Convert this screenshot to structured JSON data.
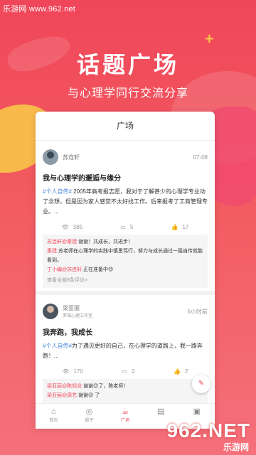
{
  "watermark": "乐游网 www.962.net",
  "hero": {
    "title": "话题广场",
    "subtitle": "与心理学同行交流分享"
  },
  "card": {
    "header": "广场"
  },
  "posts": [
    {
      "author": "苏连轩",
      "date": "07-08",
      "title": "我与心理学的邂逅与缘分",
      "tag": "#个人自传#",
      "text": " 2005年高考报志愿，我对于了解甚少的心理学专业动了念想，但是因为家人感觉不太好找工作。后来报考了工商管理专业。...",
      "views": "385",
      "comments_count": "5",
      "likes": "17",
      "comments": [
        {
          "name": "苏连轩@秦建:",
          "text": "谢谢！共成长，共进步！"
        },
        {
          "name": "秦建:",
          "text": "苏老师在心理学的实践中慎思笃行，努力与成长通过一篇自传就能看到。"
        },
        {
          "name": "丁小编@苏连轩:",
          "text": "正在准备中😊"
        }
      ],
      "more": "查看全部8条评论>"
    },
    {
      "author": "梁亚丽",
      "org": "罗福心理工作室",
      "date": "6小时前",
      "title": "我奔跑，我成长",
      "tag": "#个人自传#",
      "text": "为了遇见更好的自己，在心理学的道路上，我一路奔跑！...",
      "views": "170",
      "comments_count": "2",
      "likes": "2",
      "comments": [
        {
          "name": "梁亚丽@陈旭龙:",
          "text": "谢谢😊了，陈老师！"
        },
        {
          "name": "梁亚丽@周艺:",
          "text": "谢谢😊 了"
        }
      ]
    }
  ],
  "fab": {
    "label": "发帖"
  },
  "tabbar": [
    {
      "label": "首页",
      "icon": "home-icon",
      "glyph": "⌂"
    },
    {
      "label": "圈子",
      "icon": "compass-icon",
      "glyph": "◎"
    },
    {
      "label": "广场",
      "icon": "cup-icon",
      "glyph": "☕"
    },
    {
      "label": "",
      "icon": "book-icon",
      "glyph": "▤"
    },
    {
      "label": "",
      "icon": "bag-icon",
      "glyph": "▣"
    }
  ],
  "logo": {
    "big": "962.NET",
    "small": "乐游网"
  },
  "colors": {
    "accent": "#f0465a",
    "tag": "#4a89dc",
    "yellow": "#f8c14a"
  }
}
